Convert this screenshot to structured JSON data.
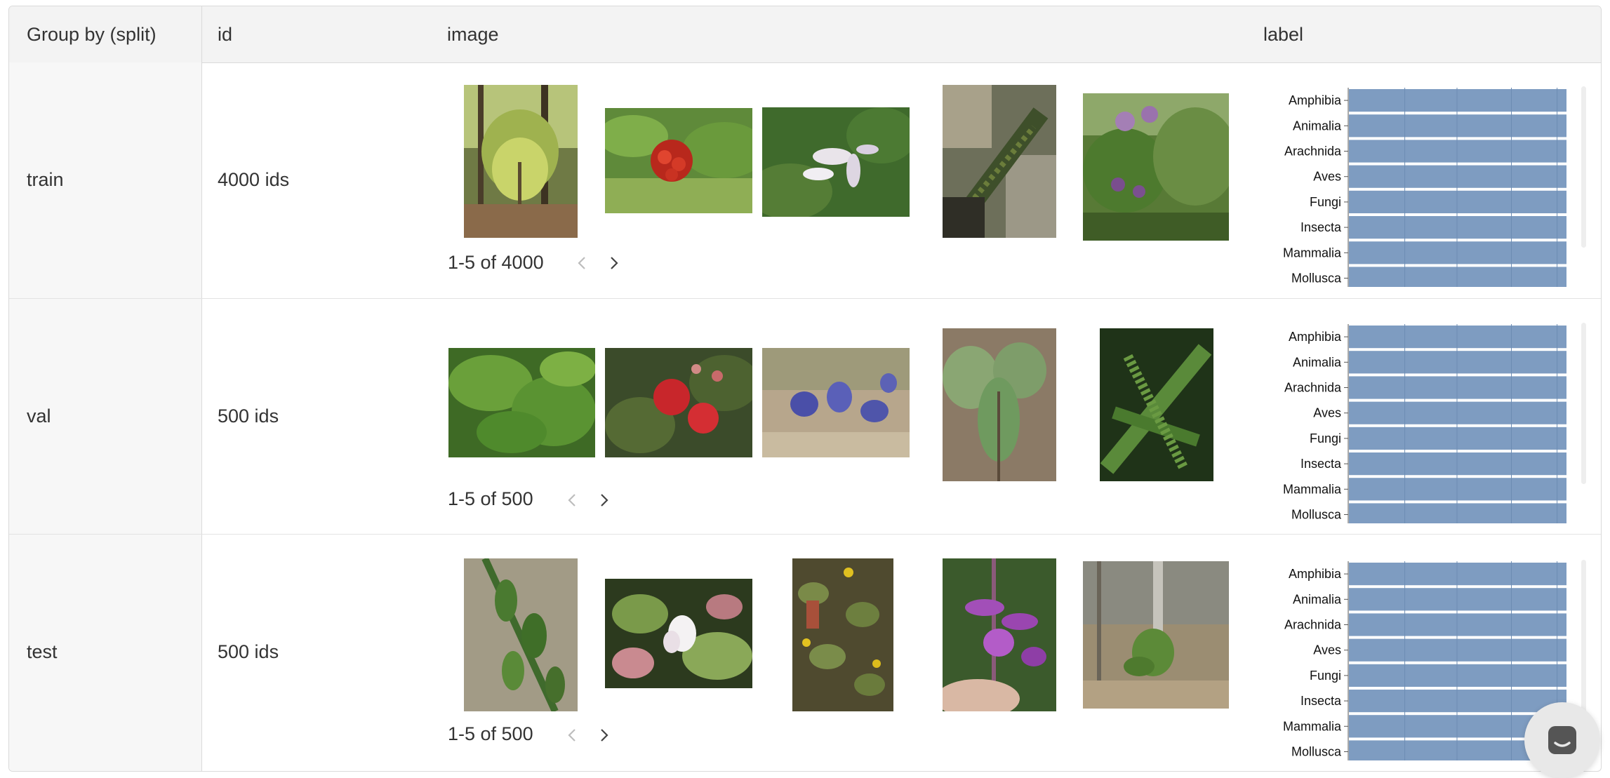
{
  "columns": {
    "group": "Group by (split)",
    "id": "id",
    "image": "image",
    "label": "label"
  },
  "label_categories": [
    "Amphibia",
    "Animalia",
    "Arachnida",
    "Aves",
    "Fungi",
    "Insecta",
    "Mammalia",
    "Mollusca"
  ],
  "colors": {
    "bar": "#7e9cc1",
    "header_bg": "#f3f3f3",
    "group_bg": "#f7f7f7",
    "border": "#dadada"
  },
  "rows": [
    {
      "split": "train",
      "ids": "4000 ids",
      "pager": "1-5 of 4000",
      "thumbnails": [
        "pine-sapling-forest",
        "red-rowan-berries",
        "white-orchid-flowers",
        "fern-on-rock",
        "purple-lilac-shrub"
      ]
    },
    {
      "split": "val",
      "ids": "500 ids",
      "pager": "1-5 of 500",
      "thumbnails": [
        "green-maple-leaves",
        "red-ohia-blossom",
        "blue-lupine-flowers",
        "bramble-leaves",
        "spruce-branch"
      ]
    },
    {
      "split": "test",
      "ids": "500 ids",
      "pager": "1-5 of 500",
      "thumbnails": [
        "shrub-on-rock",
        "pink-white-blossom",
        "purslane-yellow-flowers",
        "fireweed-purple-flowers",
        "seedling-by-tree"
      ]
    }
  ],
  "icons": {
    "prev": "chevron-left-icon",
    "next": "chevron-right-icon",
    "chat": "chat-bubble-icon"
  }
}
